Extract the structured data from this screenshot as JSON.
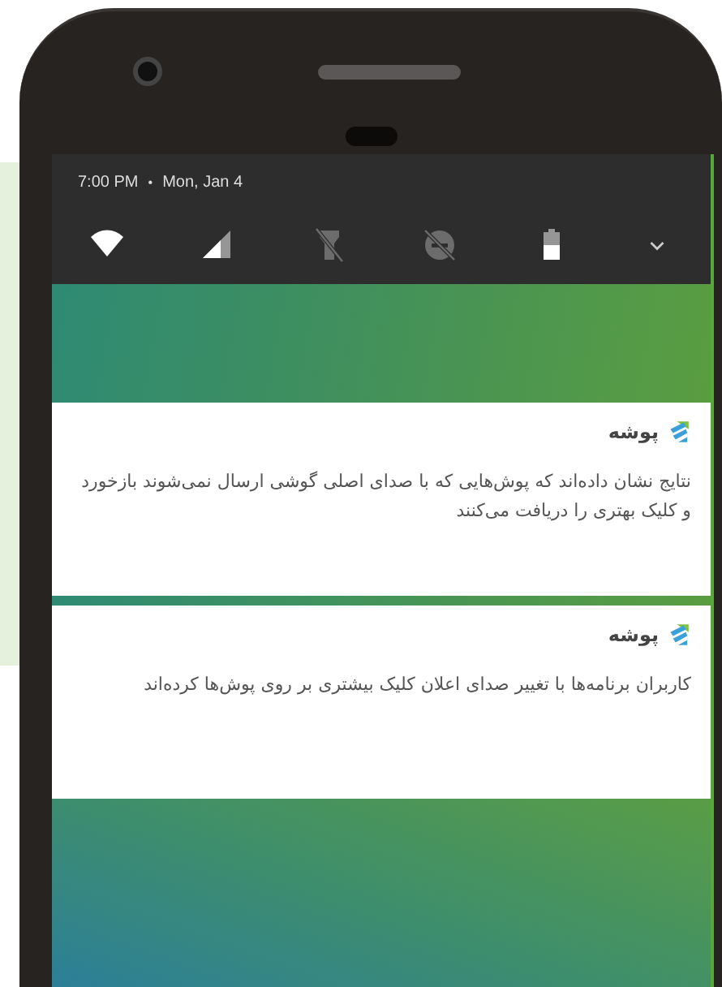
{
  "status": {
    "time": "7:00 PM",
    "separator": "•",
    "date": "Mon, Jan 4"
  },
  "quick_tiles": [
    {
      "kind": "wifi",
      "on": true
    },
    {
      "kind": "signal",
      "on": true
    },
    {
      "kind": "flashlight",
      "on": false
    },
    {
      "kind": "dnd",
      "on": false
    },
    {
      "kind": "battery",
      "on": true
    },
    {
      "kind": "expand"
    }
  ],
  "notifications": [
    {
      "app": "پوشه",
      "text": "نتایج نشان داده‌اند که پوش‌هایی که با صدای اصلی گوشی ارسال نمی‌شوند بازخورد و کلیک بهتری را دریافت می‌کنند"
    },
    {
      "app": "پوشه",
      "text": "کاربران برنامه‌ها با تغییر صدای اعلان کلیک بیشتری بر روی پوش‌ها کرده‌اند"
    }
  ]
}
